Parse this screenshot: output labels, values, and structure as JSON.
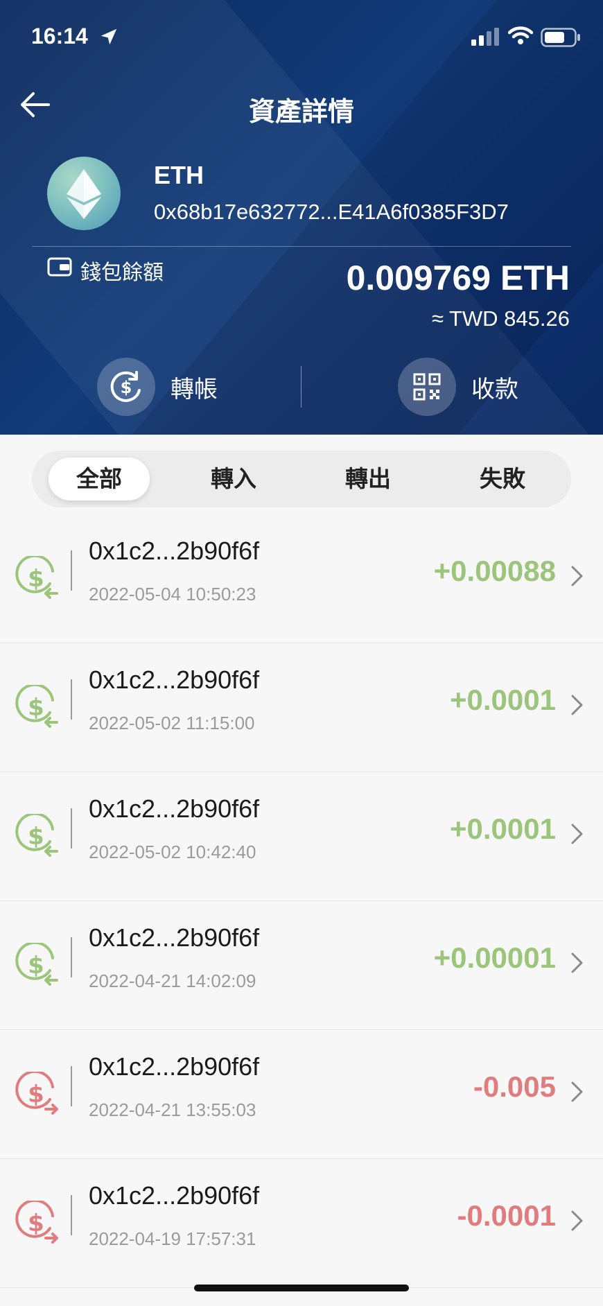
{
  "status_bar": {
    "time": "16:14"
  },
  "header": {
    "title": "資產詳情",
    "coin_symbol": "ETH",
    "coin_address": "0x68b17e632772...E41A6f0385F3D7",
    "wallet_label": "錢包餘額",
    "balance": "0.009769 ETH",
    "fiat_value": "≈ TWD 845.26",
    "actions": {
      "transfer": "轉帳",
      "receive": "收款"
    }
  },
  "tabs": [
    "全部",
    "轉入",
    "轉出",
    "失敗"
  ],
  "active_tab": "全部",
  "transactions": [
    {
      "hash": "0x1c2...2b90f6f",
      "time": "2022-05-04 10:50:23",
      "amount": "+0.00088",
      "direction": "in"
    },
    {
      "hash": "0x1c2...2b90f6f",
      "time": "2022-05-02 11:15:00",
      "amount": "+0.0001",
      "direction": "in"
    },
    {
      "hash": "0x1c2...2b90f6f",
      "time": "2022-05-02 10:42:40",
      "amount": "+0.0001",
      "direction": "in"
    },
    {
      "hash": "0x1c2...2b90f6f",
      "time": "2022-04-21 14:02:09",
      "amount": "+0.00001",
      "direction": "in"
    },
    {
      "hash": "0x1c2...2b90f6f",
      "time": "2022-04-21 13:55:03",
      "amount": "-0.005",
      "direction": "out"
    },
    {
      "hash": "0x1c2...2b90f6f",
      "time": "2022-04-19 17:57:31",
      "amount": "-0.0001",
      "direction": "out"
    }
  ],
  "colors": {
    "incoming": "#9bc57a",
    "outgoing": "#e07c7e",
    "header_bg": "#0e3170"
  },
  "icons": {
    "incoming": "dollar-in-icon",
    "outgoing": "dollar-out-icon"
  }
}
